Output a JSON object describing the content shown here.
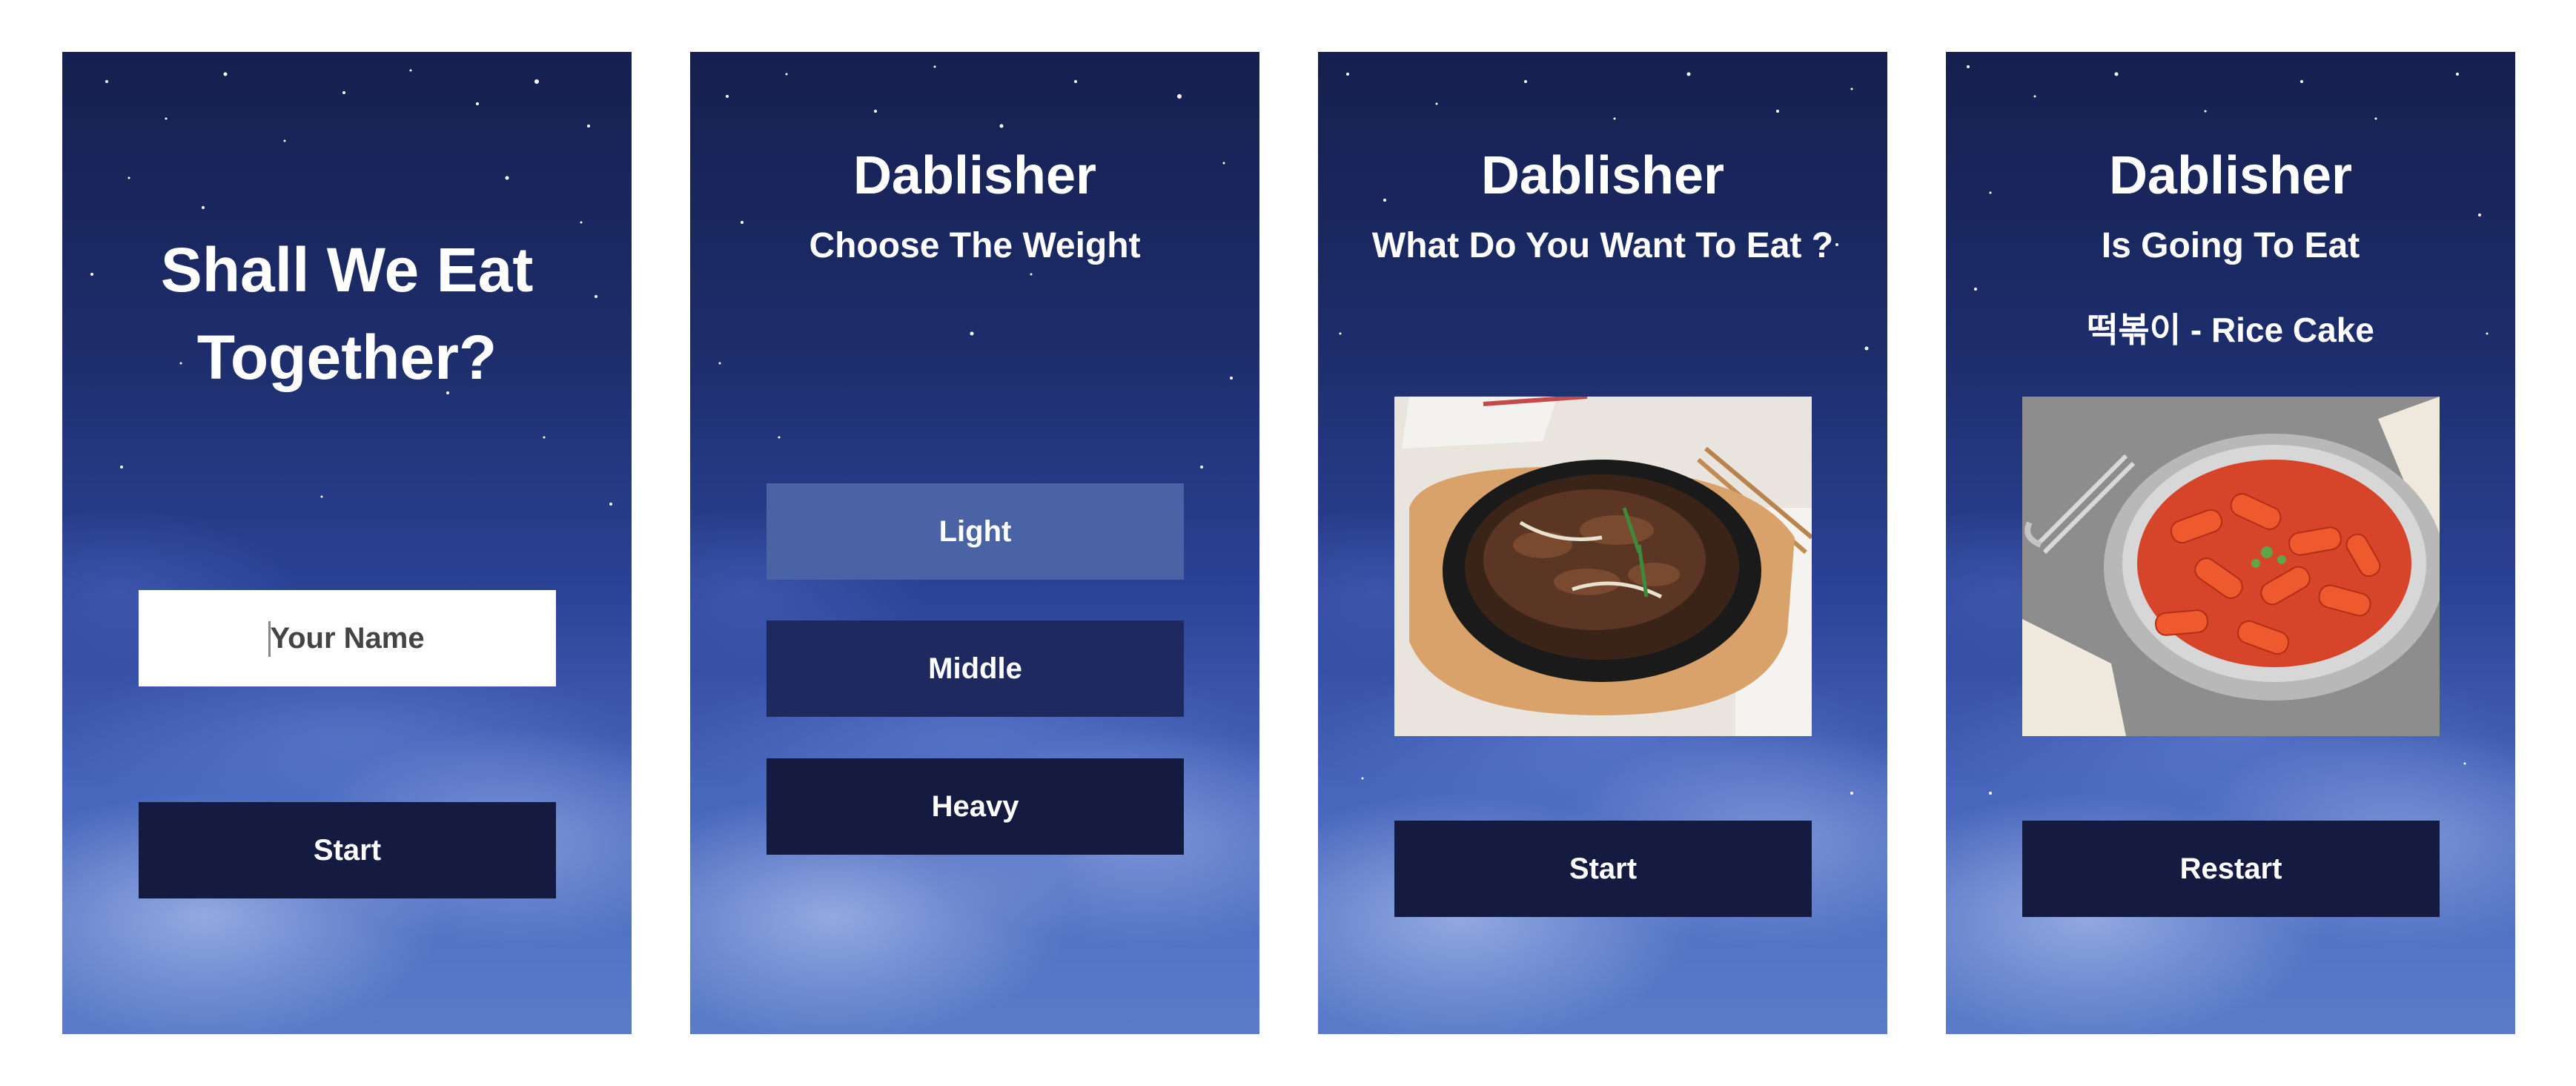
{
  "screens": [
    {
      "title": "Shall We Eat Together?",
      "name_input": {
        "placeholder": "Your Name",
        "value": ""
      },
      "start_label": "Start"
    },
    {
      "title": "Dablisher",
      "subtitle": "Choose The Weight",
      "options": [
        {
          "label": "Light",
          "selected": true
        },
        {
          "label": "Middle",
          "selected": false
        },
        {
          "label": "Heavy",
          "selected": false
        }
      ]
    },
    {
      "title": "Dablisher",
      "subtitle": "What Do You Want To Eat ?",
      "image": "bulgogi-photo",
      "start_label": "Start"
    },
    {
      "title": "Dablisher",
      "subtitle": "Is Going To Eat",
      "result": "떡볶이 - Rice Cake",
      "image": "tteokbokki-photo",
      "restart_label": "Restart"
    }
  ],
  "colors": {
    "button_dark": "#141a40",
    "button_selected": "#4a63a4",
    "sky_top": "#16204f",
    "sky_bottom": "#5a7cc8"
  }
}
